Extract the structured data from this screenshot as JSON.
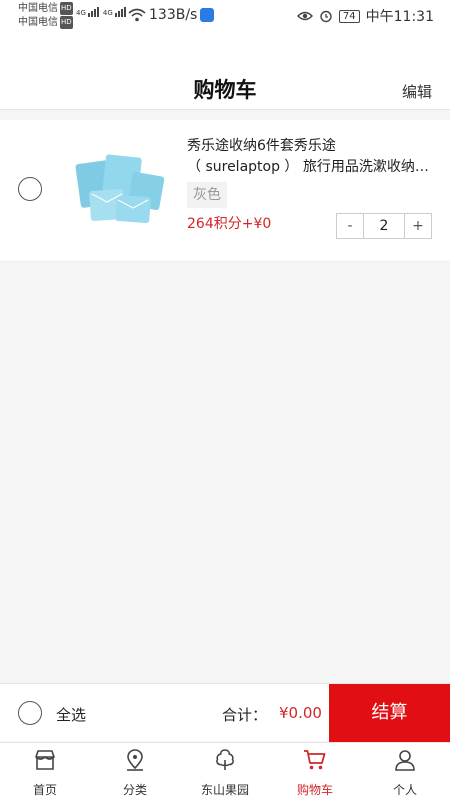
{
  "status_bar": {
    "carrier1": "中国电信",
    "carrier2": "中国电信",
    "hd": "HD",
    "net1": "4G",
    "net2": "4G",
    "speed": "133B/s",
    "battery": "74",
    "time": "中午11:31"
  },
  "header": {
    "title": "购物车",
    "edit": "编辑"
  },
  "cart_item": {
    "name_line1": "秀乐途收纳6件套秀乐途",
    "name_line2": "（ surelaptop ） 旅行用品洗漱收纳袋...",
    "spec": "灰色",
    "price": "264积分+¥0",
    "qty": "2",
    "minus": "-",
    "plus": "+",
    "image_color": "#8fd3e8"
  },
  "checkout": {
    "select_all": "全选",
    "total_label": "合计：",
    "total_value": "¥0.00",
    "settle": "结算",
    "accent": "#e10e14"
  },
  "tabs": [
    {
      "label": "首页",
      "icon": "store-icon"
    },
    {
      "label": "分类",
      "icon": "location-pin-icon"
    },
    {
      "label": "东山果园",
      "icon": "tree-icon"
    },
    {
      "label": "购物车",
      "icon": "cart-icon",
      "active": true
    },
    {
      "label": "个人",
      "icon": "user-icon"
    }
  ]
}
